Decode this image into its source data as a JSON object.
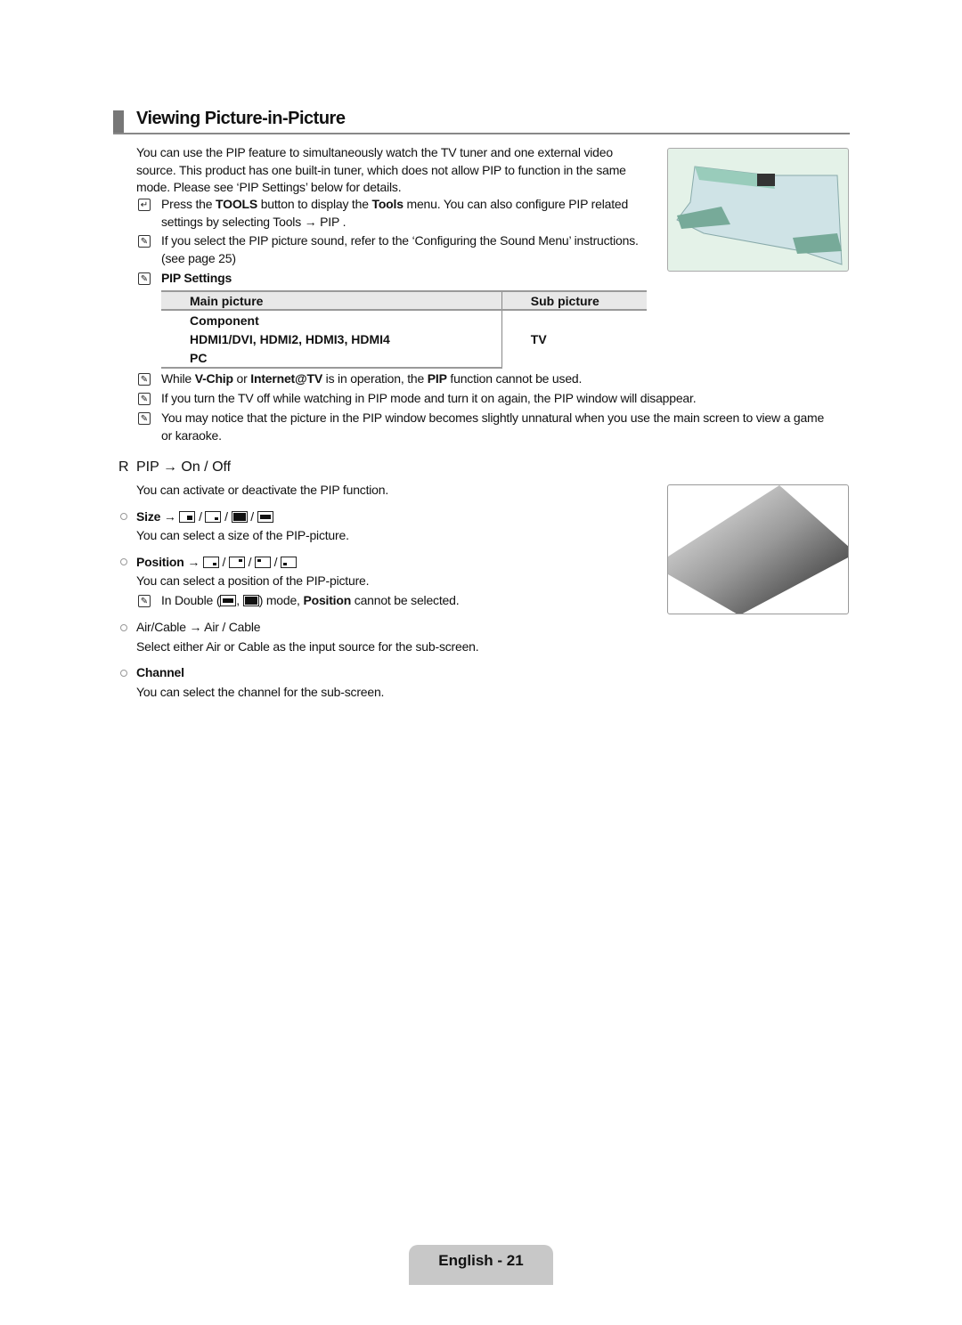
{
  "title": "Viewing Picture-in-Picture",
  "intro": [
    "You can use the PIP feature to simultaneously watch the TV tuner and one external video",
    "source. This product has one built-in tuner, which does not allow PIP to function in the same",
    "mode. Please see ‘PIP Settings’ below for details."
  ],
  "tools_note": {
    "a": "Press the ",
    "b": "TOOLS",
    "c": " button to display the ",
    "d": "Tools",
    "e": " menu. You can also configure PIP related",
    "line2": "settings by selecting Tools → PIP ."
  },
  "sound_note": {
    "line1": "If you select the PIP picture sound, refer to the ‘Configuring the Sound Menu’ instructions.",
    "line2": "(see page 25)"
  },
  "pip_settings_label": "PIP Settings",
  "table": {
    "headers": [
      "Main picture",
      "Sub picture"
    ],
    "main": [
      "Component",
      "HDMI1/DVI, HDMI2, HDMI3, HDMI4",
      "PC"
    ],
    "sub": "TV"
  },
  "notes": [
    {
      "a": "While ",
      "b": "V-Chip",
      "c": " or ",
      "d": "Internet@TV",
      "e": " is in operation, the ",
      "f": "PIP",
      "g": " function cannot be used."
    },
    {
      "text": "If you turn the TV off while watching in PIP mode and turn it on again, the PIP window will disappear."
    },
    {
      "line1": "You may notice that the picture in the PIP window becomes slightly unnatural when you use the main screen to view a game",
      "line2": "or karaoke."
    }
  ],
  "pip_section": {
    "marker": "R",
    "heading": "PIP → On / Off",
    "desc": "You can activate or deactivate the PIP function."
  },
  "items": {
    "size": {
      "label": "Size",
      "arrow": " → ",
      "desc": "You can select a size of the PIP-picture."
    },
    "position": {
      "label": "Position",
      "arrow": " → ",
      "desc": "You can select a position of the PIP-picture.",
      "note_a": "In Double (",
      "note_b": ") mode, ",
      "note_c": "Position",
      "note_d": " cannot be selected."
    },
    "aircable": {
      "label": "Air/Cable → Air / Cable",
      "desc": "Select either Air or Cable as the input source for the sub-screen."
    },
    "channel": {
      "label": "Channel",
      "desc": "You can select the channel for the sub-screen."
    }
  },
  "footer": "English - 21"
}
